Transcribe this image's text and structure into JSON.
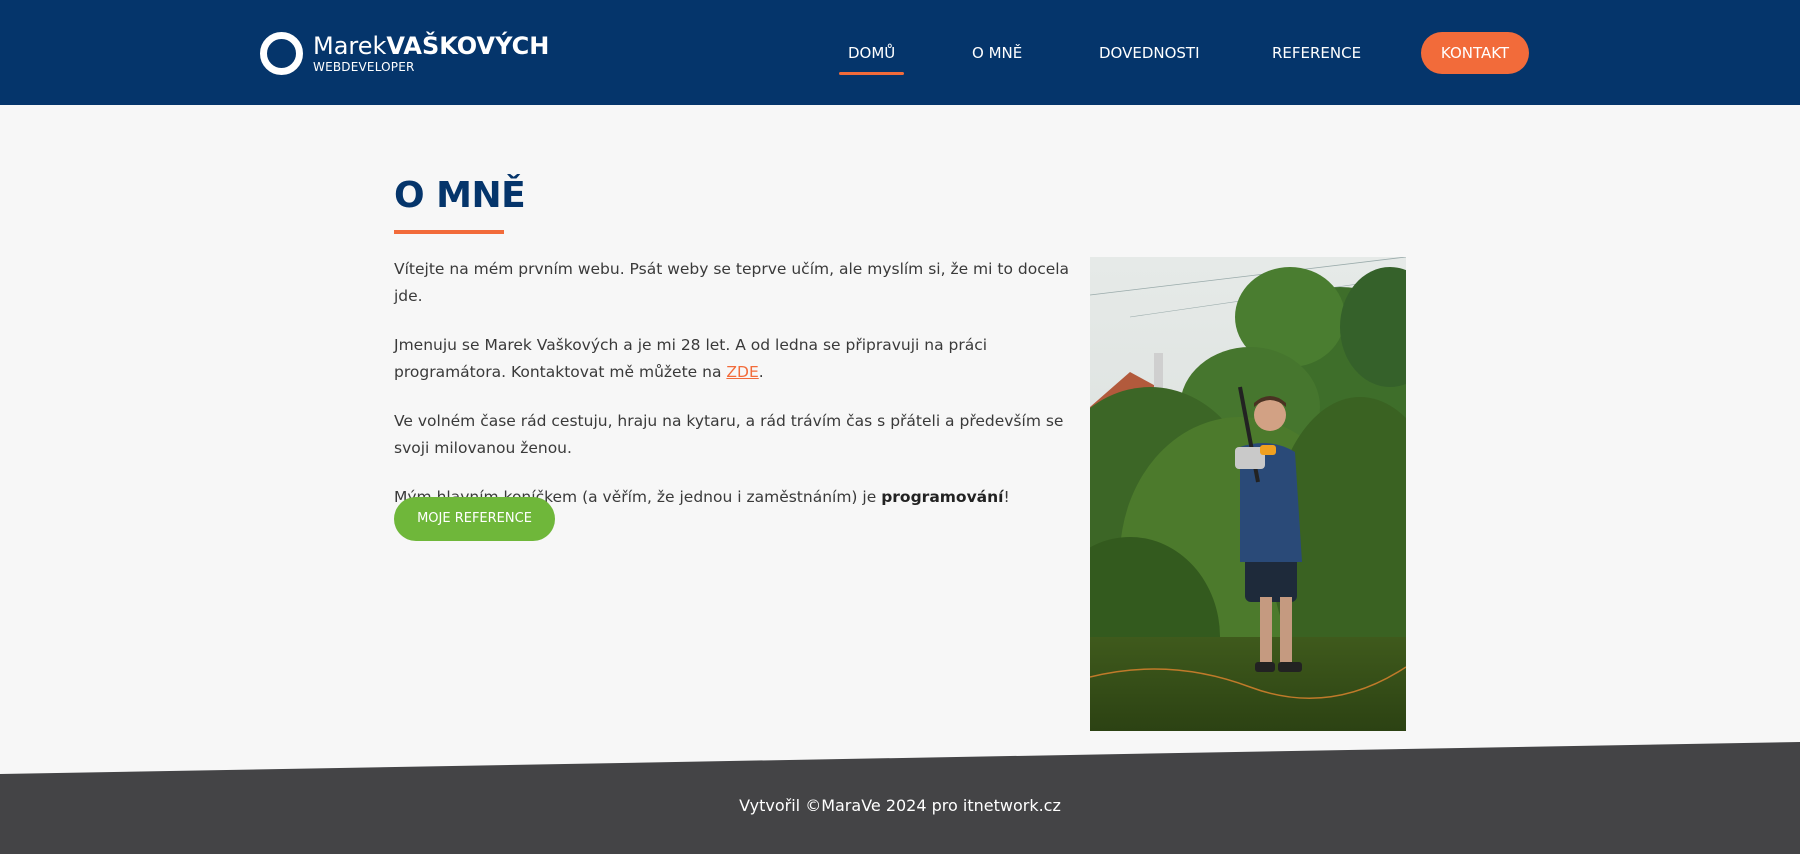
{
  "header": {
    "logo": {
      "first": "Marek",
      "last": "VAŠKOVÝCH",
      "subtitle": "WEBDEVELOPER"
    },
    "nav": [
      {
        "label": "DOMŮ",
        "active": true
      },
      {
        "label": "O MNĚ",
        "active": false
      },
      {
        "label": "DOVEDNOSTI",
        "active": false
      },
      {
        "label": "REFERENCE",
        "active": false
      }
    ],
    "contact_label": "KONTAKT"
  },
  "about": {
    "title": "O MNĚ",
    "p1": "Vítejte na mém prvním webu. Psát weby se teprve učím, ale myslím si, že mi to docela jde.",
    "p2_before": "Jmenuju se Marek Vaškových a je mi 28 let. A od ledna se připravuji na práci programátora. Kontaktovat mě můžete na ",
    "p2_link": "ZDE",
    "p2_after": ".",
    "p3": "Ve volném čase rád cestuju, hraju na kytaru, a rád trávím čas s přáteli a především se svoji milovanou ženou.",
    "p4_before": "Mým hlavním koníčkem (a věřím, že jednou i zaměstnáním) je ",
    "p4_bold": "programování",
    "p4_after": "!",
    "button_label": "MOJE REFERENCE"
  },
  "footer": {
    "text": "Vytvořil ©MaraVe 2024 pro itnetwork.cz"
  },
  "colors": {
    "navy": "#05356b",
    "orange": "#f26b3a",
    "green": "#6fb73a",
    "footer": "#444446"
  }
}
